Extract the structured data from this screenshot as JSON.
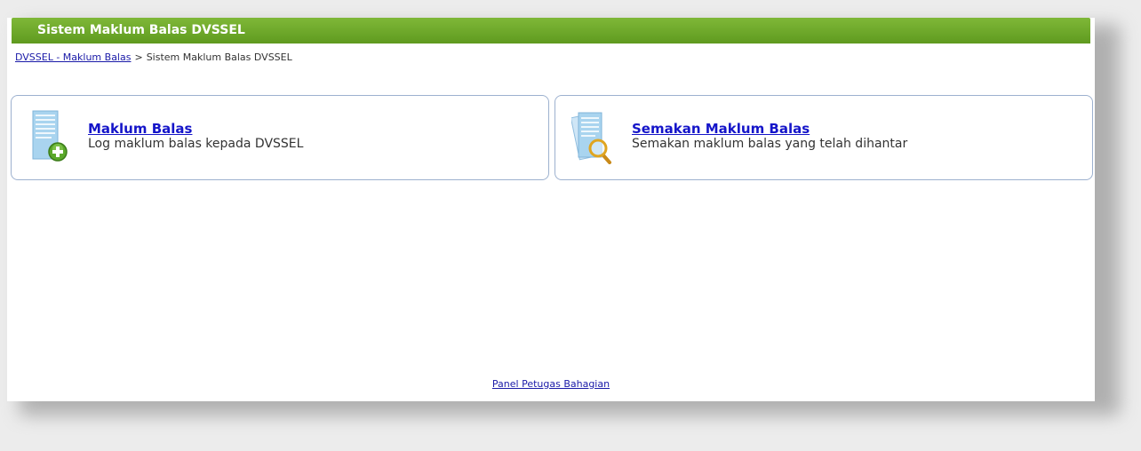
{
  "header": {
    "title": "Sistem Maklum Balas DVSSEL"
  },
  "breadcrumb": {
    "link": "DVSSEL - Maklum Balas",
    "separator": ">",
    "current": "Sistem Maklum Balas DVSSEL"
  },
  "cards": [
    {
      "title": "Maklum Balas",
      "description": "Log maklum balas kepada DVSSEL",
      "icon": "document-add-icon"
    },
    {
      "title": "Semakan Maklum Balas",
      "description": "Semakan maklum balas yang telah dihantar",
      "icon": "document-search-icon"
    }
  ],
  "footer": {
    "link": "Panel Petugas Bahagian"
  },
  "colors": {
    "header_green": "#6aa628",
    "link_blue": "#1515c9",
    "card_border": "#9db1cf"
  }
}
